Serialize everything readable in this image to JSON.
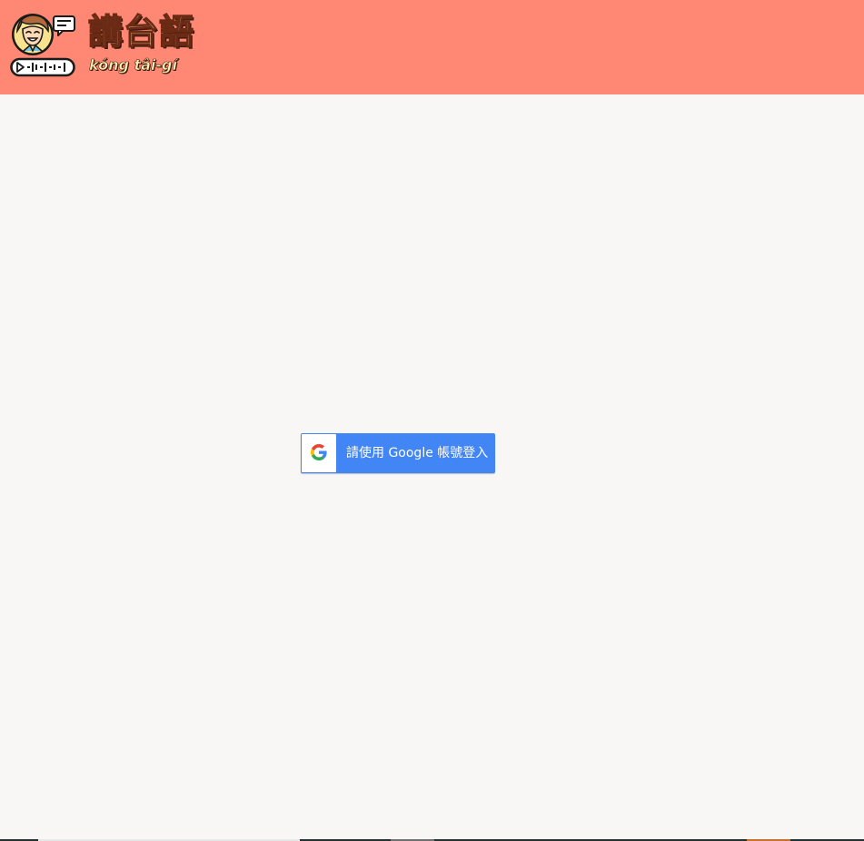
{
  "header": {
    "brand_cjk": "講台語",
    "brand_roman": "kóng tâi-gí",
    "logo_icon": "talking-face-audio-icon",
    "background_color": "#ff8874"
  },
  "login": {
    "google_button_label": "請使用 Google 帳號登入",
    "google_icon": "google-g-icon",
    "button_color": "#4285f4"
  },
  "page": {
    "background_color": "#f9f7f6"
  }
}
